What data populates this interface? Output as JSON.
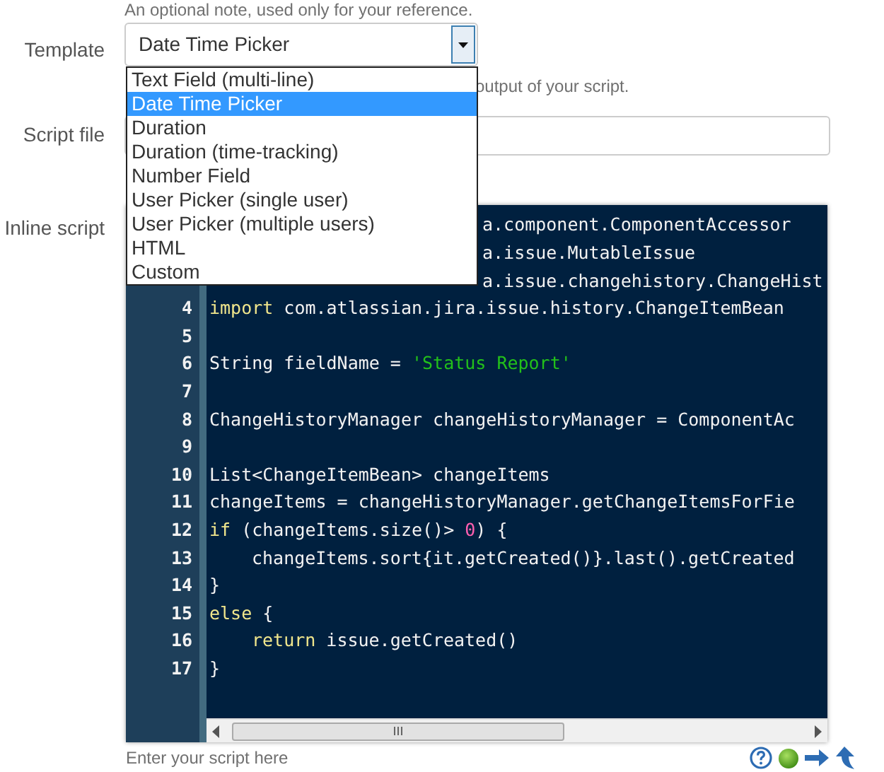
{
  "top_note": "An optional note, used only for your reference.",
  "template": {
    "label": "Template",
    "value": "Date Time Picker",
    "expanded": true,
    "options": [
      {
        "label": "Text Field (multi-line)",
        "selected": false
      },
      {
        "label": "Date Time Picker",
        "selected": true
      },
      {
        "label": "Duration",
        "selected": false
      },
      {
        "label": "Duration (time-tracking)",
        "selected": false
      },
      {
        "label": "Number Field",
        "selected": false
      },
      {
        "label": "User Picker (single user)",
        "selected": false
      },
      {
        "label": "User Picker (multiple users)",
        "selected": false
      },
      {
        "label": "HTML",
        "selected": false
      },
      {
        "label": "Custom",
        "selected": false
      }
    ],
    "hint": "output of your script."
  },
  "script_file": {
    "label": "Script file"
  },
  "inline_script": {
    "label": "Inline script",
    "hint": "Enter your script here",
    "lines": [
      {
        "kind": "covered",
        "tokens": [
          {
            "kind": "plain",
            "s": "a.component.ComponentAccessor"
          }
        ]
      },
      {
        "kind": "covered",
        "tokens": [
          {
            "kind": "plain",
            "s": "a.issue.MutableIssue"
          }
        ]
      },
      {
        "kind": "covered",
        "tokens": [
          {
            "kind": "plain",
            "s": "a.issue.changehistory.ChangeHist"
          }
        ]
      },
      {
        "kind": "code",
        "number": "4",
        "tokens": [
          {
            "kind": "keyword",
            "s": "import"
          },
          {
            "kind": "plain",
            "s": " com.atlassian.jira.issue.history.ChangeItemBean"
          }
        ]
      },
      {
        "kind": "blank",
        "number": "5"
      },
      {
        "kind": "code",
        "number": "6",
        "tokens": [
          {
            "kind": "plain",
            "s": "String fieldName = "
          },
          {
            "kind": "string",
            "s": "'Status Report'"
          }
        ]
      },
      {
        "kind": "blank",
        "number": "7"
      },
      {
        "kind": "code",
        "number": "8",
        "tokens": [
          {
            "kind": "plain",
            "s": "ChangeHistoryManager changeHistoryManager = ComponentAc"
          }
        ]
      },
      {
        "kind": "blank",
        "number": "9"
      },
      {
        "kind": "code",
        "number": "10",
        "tokens": [
          {
            "kind": "plain",
            "s": "List<ChangeItemBean> changeItems"
          }
        ]
      },
      {
        "kind": "code",
        "number": "11",
        "tokens": [
          {
            "kind": "plain",
            "s": "changeItems = changeHistoryManager.getChangeItemsForFie"
          }
        ]
      },
      {
        "kind": "code",
        "number": "12",
        "tokens": [
          {
            "kind": "keyword",
            "s": "if"
          },
          {
            "kind": "plain",
            "s": " (changeItems.size()> "
          },
          {
            "kind": "number",
            "s": "0"
          },
          {
            "kind": "plain",
            "s": ") {"
          }
        ]
      },
      {
        "kind": "indented",
        "number": "13",
        "tokens": [
          {
            "kind": "plain",
            "s": "changeItems.sort{it.getCreated()}.last().getCreated"
          }
        ]
      },
      {
        "kind": "code",
        "number": "14",
        "tokens": [
          {
            "kind": "plain",
            "s": "}"
          }
        ]
      },
      {
        "kind": "code",
        "number": "15",
        "tokens": [
          {
            "kind": "keyword",
            "s": "else"
          },
          {
            "kind": "plain",
            "s": " {"
          }
        ]
      },
      {
        "kind": "indented",
        "number": "16",
        "tokens": [
          {
            "kind": "keyword",
            "s": "return"
          },
          {
            "kind": "plain",
            "s": " issue.getCreated()"
          }
        ]
      },
      {
        "kind": "code",
        "number": "17",
        "tokens": [
          {
            "kind": "plain",
            "s": "}"
          }
        ]
      }
    ]
  }
}
